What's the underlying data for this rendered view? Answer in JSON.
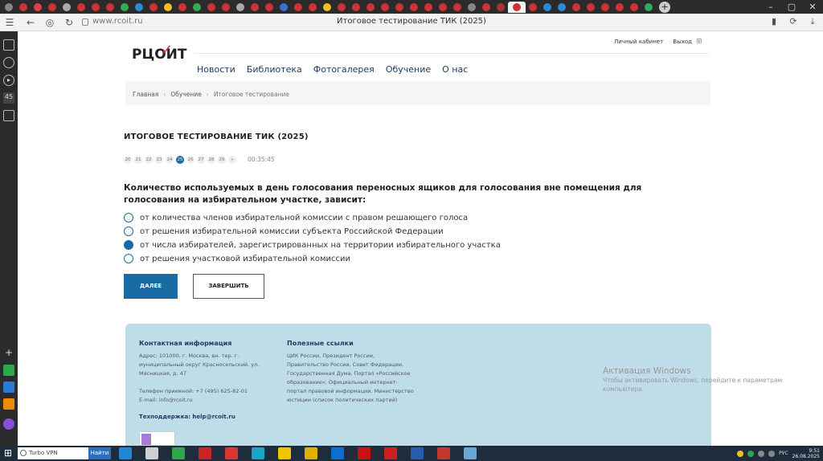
{
  "browser": {
    "url": "www.rcoit.ru",
    "title": "Итоговое тестирование ТИК (2025)",
    "tab_colors": [
      "#888",
      "#cc3333",
      "#e04040",
      "#cc3333",
      "#aaa",
      "#cc3333",
      "#cc3333",
      "#cc3333",
      "#33aa55",
      "#2a8ad4",
      "#cc3333",
      "#f0c020",
      "#cc3333",
      "#33aa55",
      "#cc3333",
      "#cc3333",
      "#aaa",
      "#cc3333",
      "#cc3333",
      "#3a6fd4",
      "#cc3333",
      "#cc3333",
      "#f0c020",
      "#cc3333",
      "#cc3333",
      "#cc3333",
      "#cc3333",
      "#cc3333",
      "#cc3333",
      "#cc3333",
      "#cc3333",
      "#cc3333",
      "#888",
      "#cc3333",
      "#aa3333",
      "#cc3333",
      "#cc3333",
      "#2a8ad4",
      "#2a8ad4",
      "#cc3333",
      "#cc3333",
      "#cc3333",
      "#cc3333",
      "#cc3333",
      "#33aa55"
    ],
    "sidebar_badge": "45"
  },
  "site": {
    "logo": "РЦОИТ",
    "header_links": [
      "Личный кабинет",
      "Выход"
    ],
    "nav": [
      "Новости",
      "Библиотека",
      "Фотогалерея",
      "Обучение",
      "О нас"
    ],
    "breadcrumb": [
      "Главная",
      "Обучение",
      "Итоговое тестирование"
    ]
  },
  "test": {
    "title": "ИТОГОВОЕ ТЕСТИРОВАНИЕ ТИК (2025)",
    "question_numbers": [
      "20",
      "21",
      "22",
      "23",
      "24",
      "25",
      "26",
      "27",
      "28",
      "29",
      "»"
    ],
    "current": "25",
    "timer": "00:35:45",
    "question": "Количество используемых в день голосования переносных ящиков для голосования вне помещения для голосования на избирательном участке, зависит:",
    "options": [
      "от количества членов избирательной комиссии с правом решающего голоса",
      "от решения избирательной комиссии субъекта Российской Федерации",
      "от числа избирателей, зарегистрированных на территории избирательного участка",
      "от решения участковой избирательной комиссии"
    ],
    "selected_index": 2,
    "next_label": "ДАЛЕЕ",
    "finish_label": "ЗАВЕРШИТЬ"
  },
  "footer": {
    "contact_title": "Контактная информация",
    "address": "Адрес: 101000, г. Москва, вн. тер. г. муниципальный округ Красносельский, ул. Мясницкая, д. 47",
    "phone": "Телефон приемной: +7 (495) 625-82-01",
    "email": "E-mail: info@rcoit.ru",
    "support": "Техподдержка: help@rcoit.ru",
    "links_title": "Полезные ссылки",
    "links": "ЦИК России, Президент России, Правительство России, Совет Федерации, Государственная Дума, Портал «Российское образование», Официальный интернет-портал правовой информации, Министерство юстиции (список политических партий)"
  },
  "activation": {
    "title": "Активация Windows",
    "subtitle": "Чтобы активировать Windows, перейдите к параметрам компьютера."
  },
  "taskbar": {
    "search_text": "Turbo VPN",
    "search_button": "Найти",
    "app_colors": [
      "#1e88d6",
      "#cfcfcf",
      "#2aa84a",
      "#cc2222",
      "#e03333",
      "#1aa4c8",
      "#f2c400",
      "#e0b000",
      "#0a6fd0",
      "#cc1111",
      "#cc2020",
      "#2a5bb0",
      "#c0392b",
      "#6aa6d8"
    ],
    "lang": "РУС",
    "time": "9:51",
    "date": "26.08.2025"
  }
}
